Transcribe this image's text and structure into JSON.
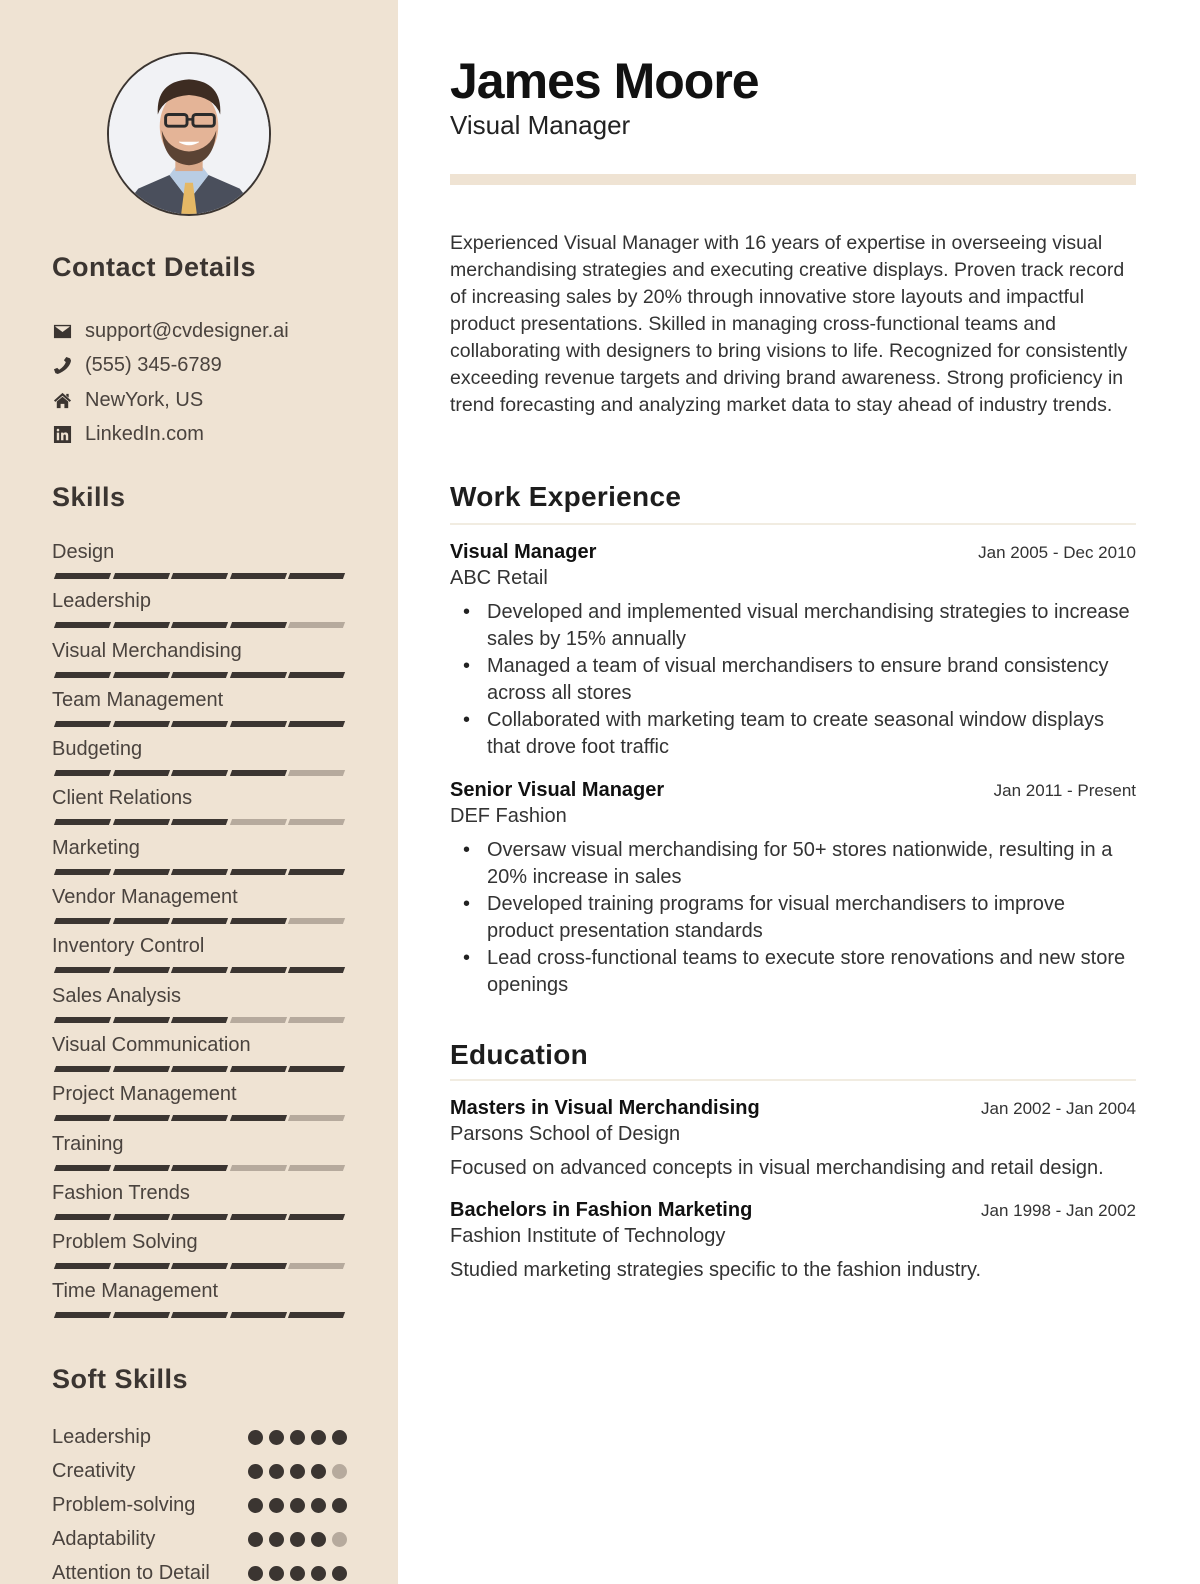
{
  "profile": {
    "name": "James Moore",
    "title": "Visual Manager",
    "photo_alt": "profile-photo",
    "summary": "Experienced Visual Manager with 16 years of expertise in overseeing visual merchandising strategies and executing creative displays. Proven track record of increasing sales by 20% through innovative store layouts and impactful product presentations. Skilled in managing cross-functional teams and collaborating with designers to bring visions to life. Recognized for consistently exceeding revenue targets and driving brand awareness. Strong proficiency in trend forecasting and analyzing market data to stay ahead of industry trends."
  },
  "colors": {
    "sidebar_bg": "#efe3d3",
    "accent_dark": "#3b3531",
    "accent_muted": "#b6aa9d"
  },
  "contact": {
    "heading": "Contact Details",
    "items": [
      {
        "icon": "envelope-icon",
        "text": "support@cvdesigner.ai"
      },
      {
        "icon": "phone-icon",
        "text": "(555) 345-6789"
      },
      {
        "icon": "home-icon",
        "text": "NewYork, US"
      },
      {
        "icon": "linkedin-icon",
        "text": "LinkedIn.com"
      }
    ]
  },
  "skills": {
    "heading": "Skills",
    "max": 5,
    "items": [
      {
        "name": "Design",
        "level": 5
      },
      {
        "name": "Leadership",
        "level": 4
      },
      {
        "name": "Visual Merchandising",
        "level": 5
      },
      {
        "name": "Team Management",
        "level": 5
      },
      {
        "name": "Budgeting",
        "level": 4
      },
      {
        "name": "Client Relations",
        "level": 3
      },
      {
        "name": "Marketing",
        "level": 5
      },
      {
        "name": "Vendor Management",
        "level": 4
      },
      {
        "name": "Inventory Control",
        "level": 5
      },
      {
        "name": "Sales Analysis",
        "level": 3
      },
      {
        "name": "Visual Communication",
        "level": 5
      },
      {
        "name": "Project Management",
        "level": 4
      },
      {
        "name": "Training",
        "level": 3
      },
      {
        "name": "Fashion Trends",
        "level": 5
      },
      {
        "name": "Problem Solving",
        "level": 4
      },
      {
        "name": "Time Management",
        "level": 5
      }
    ]
  },
  "soft_skills": {
    "heading": "Soft Skills",
    "max": 5,
    "items": [
      {
        "name": "Leadership",
        "level": 5
      },
      {
        "name": "Creativity",
        "level": 4
      },
      {
        "name": "Problem-solving",
        "level": 5
      },
      {
        "name": "Adaptability",
        "level": 4
      },
      {
        "name": "Attention to Detail",
        "level": 5
      }
    ]
  },
  "work": {
    "heading": "Work Experience",
    "items": [
      {
        "title": "Visual Manager",
        "company": "ABC Retail",
        "dates": "Jan 2005 - Dec 2010",
        "bullets": [
          "Developed and implemented visual merchandising strategies to increase sales by 15% annually",
          "Managed a team of visual merchandisers to ensure brand consistency across all stores",
          "Collaborated with marketing team to create seasonal window displays that drove foot traffic"
        ]
      },
      {
        "title": "Senior Visual Manager",
        "company": "DEF Fashion",
        "dates": "Jan 2011 - Present",
        "bullets": [
          "Oversaw visual merchandising for 50+ stores nationwide, resulting in a 20% increase in sales",
          "Developed training programs for visual merchandisers to improve product presentation standards",
          "Lead cross-functional teams to execute store renovations and new store openings"
        ]
      }
    ]
  },
  "education": {
    "heading": "Education",
    "items": [
      {
        "degree": "Masters in Visual Merchandising",
        "school": "Parsons School of Design",
        "dates": "Jan 2002 - Jan 2004",
        "description": "Focused on advanced concepts in visual merchandising and retail design."
      },
      {
        "degree": "Bachelors in Fashion Marketing",
        "school": "Fashion Institute of Technology",
        "dates": "Jan 1998 - Jan 2002",
        "description": "Studied marketing strategies specific to the fashion industry."
      }
    ]
  }
}
